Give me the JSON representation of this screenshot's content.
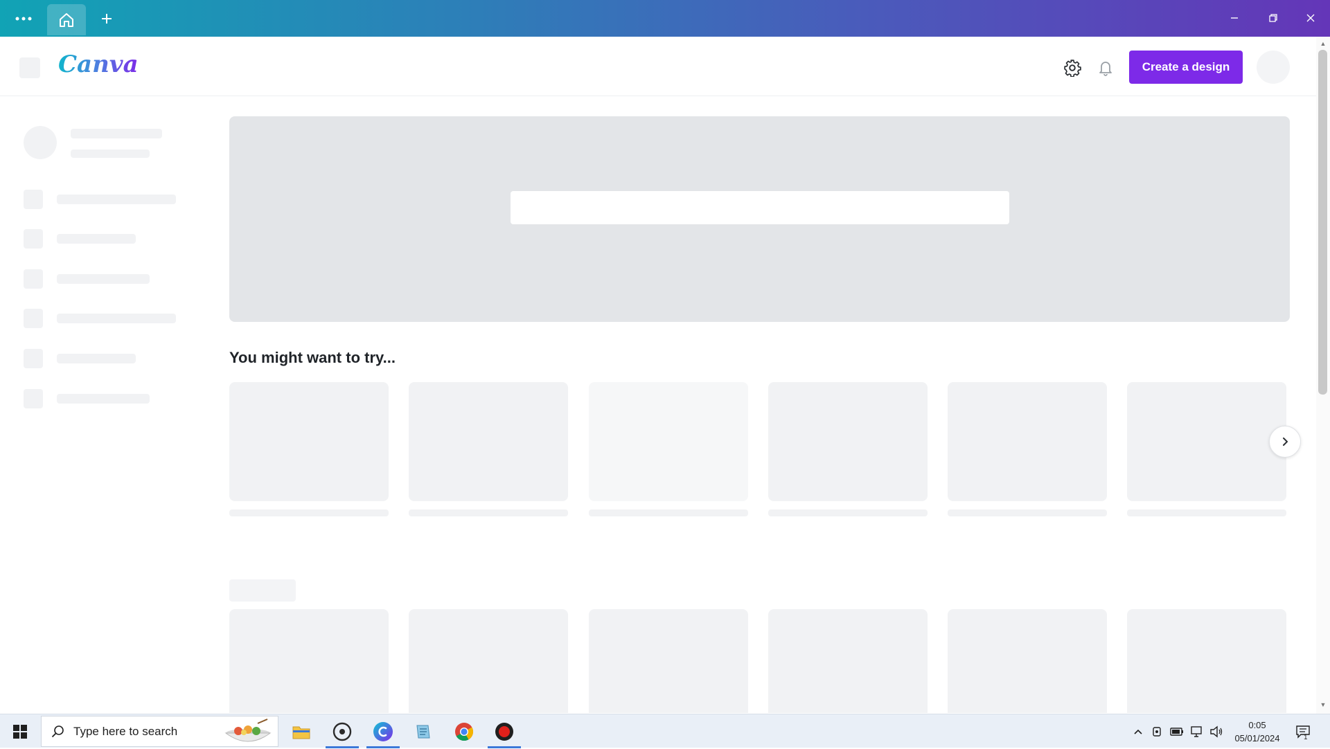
{
  "app": {
    "logo_text": "Canva",
    "brand_color": "#7d2ae8"
  },
  "titlebar": {
    "menu_icon": "more-dots-icon",
    "home_icon": "home-icon",
    "new_tab_icon": "plus-icon",
    "window_controls": [
      "minimize-icon",
      "restore-icon",
      "close-icon"
    ]
  },
  "header": {
    "settings_icon": "gear-icon",
    "notifications_icon": "bell-icon",
    "create_button_label": "Create a design"
  },
  "main": {
    "section_title": "You might want to try...",
    "next_icon": "chevron-right-icon"
  },
  "taskbar": {
    "search_placeholder": "Type here to search",
    "apps": [
      "file-explorer-icon",
      "media-icon",
      "canva-icon",
      "notepad-icon",
      "chrome-icon",
      "record-icon"
    ],
    "tray_icons": [
      "chevron-up-icon",
      "meet-icon",
      "battery-icon",
      "network-icon",
      "volume-icon"
    ],
    "time": "0:05",
    "date": "05/01/2024",
    "notification_count": "1"
  }
}
